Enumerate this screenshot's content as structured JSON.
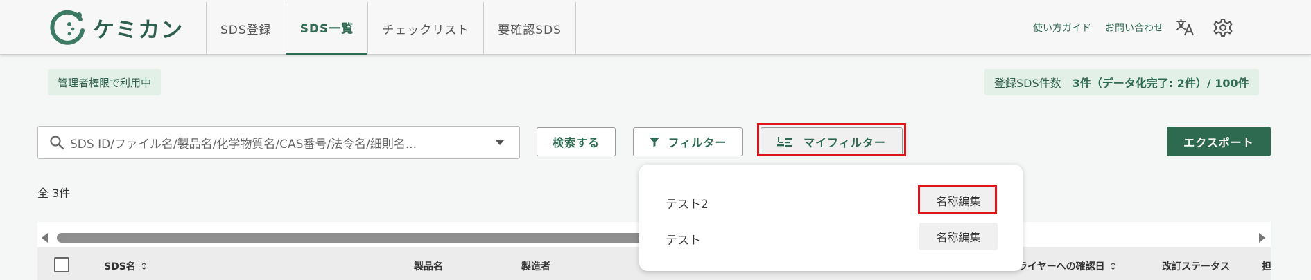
{
  "app": {
    "logo_text": "ケミカン",
    "brand_color": "#2f6a52"
  },
  "nav": {
    "tabs": [
      {
        "label": "SDS登録",
        "active": false
      },
      {
        "label": "SDS一覧",
        "active": true
      },
      {
        "label": "チェックリスト",
        "active": false
      },
      {
        "label": "要確認SDS",
        "active": false
      }
    ]
  },
  "header": {
    "guide_link": "使い方ガイド",
    "contact_link": "お問い合わせ",
    "translate_icon": "translate-icon",
    "settings_icon": "gear-icon"
  },
  "badges": {
    "admin": "管理者権限で利用中",
    "count_label": "登録SDS件数",
    "count_value": "3件（データ化完了: 2件）/ 100件"
  },
  "toolbar": {
    "search_placeholder": "SDS ID/ファイル名/製品名/化学物質名/CAS番号/法令名/細則名...",
    "search_button": "検索する",
    "filter_button": "フィルター",
    "my_filter_button": "マイフィルター",
    "export_button": "エクスポート"
  },
  "results": {
    "total": "全 3件"
  },
  "table": {
    "columns": {
      "sds_name": "SDS名",
      "product_name": "製品名",
      "manufacturer": "製造者",
      "supplier_confirm_date": "サプライヤーへの確認日",
      "revision_status": "改訂ステータス",
      "last_partial": "担"
    },
    "sort_icon": "↕"
  },
  "my_filters": {
    "items": [
      {
        "name": "テスト2",
        "edit_label": "名称編集"
      },
      {
        "name": "テスト",
        "edit_label": "名称編集"
      }
    ]
  }
}
